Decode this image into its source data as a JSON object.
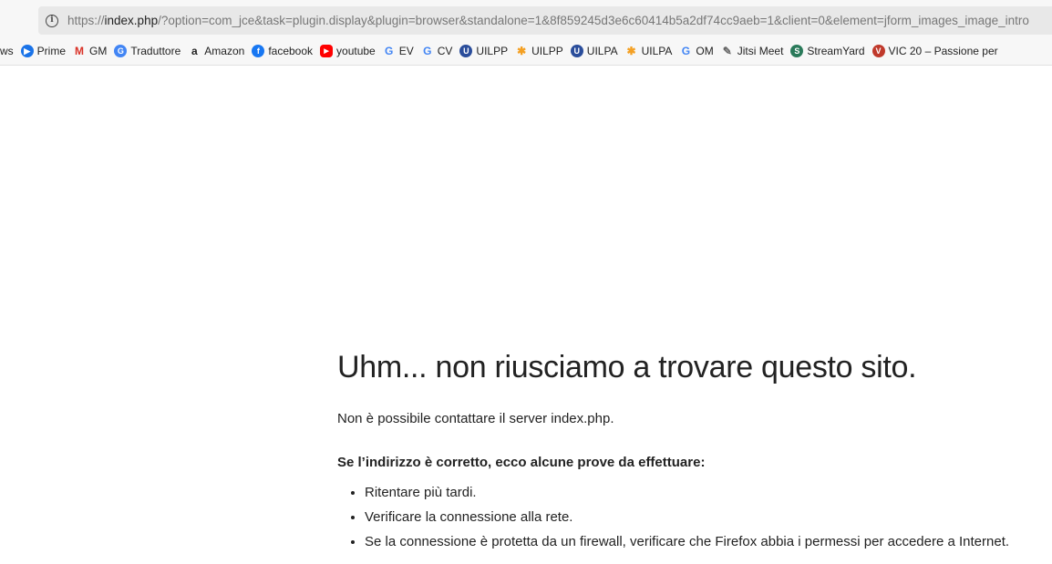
{
  "address_bar": {
    "scheme": "https://",
    "host": "index.php",
    "rest": "/?option=com_jce&task=plugin.display&plugin=browser&standalone=1&8f859245d3e6c60414b5a2df74cc9aeb=1&client=0&element=jform_images_image_intro"
  },
  "bookmarks": [
    {
      "label": "ws",
      "icon": "none",
      "color": ""
    },
    {
      "label": "Prime",
      "icon": "play-icon",
      "color": "#1a73e8"
    },
    {
      "label": "GM",
      "icon": "gmail-icon",
      "color": "#d93025"
    },
    {
      "label": "Traduttore",
      "icon": "translate-icon",
      "color": "#4285f4"
    },
    {
      "label": "Amazon",
      "icon": "amazon-icon",
      "color": "#222"
    },
    {
      "label": "facebook",
      "icon": "facebook-icon",
      "color": "#1877f2"
    },
    {
      "label": "youtube",
      "icon": "youtube-icon",
      "color": "#ff0000"
    },
    {
      "label": "EV",
      "icon": "google-icon",
      "color": "#4285f4"
    },
    {
      "label": "CV",
      "icon": "google-icon",
      "color": "#4285f4"
    },
    {
      "label": "UILPP",
      "icon": "uil-icon",
      "color": "#2a4d9b"
    },
    {
      "label": "UILPP",
      "icon": "joomla-icon",
      "color": "#f4a023"
    },
    {
      "label": "UILPA",
      "icon": "uil-icon",
      "color": "#2a4d9b"
    },
    {
      "label": "UILPA",
      "icon": "joomla-icon",
      "color": "#f4a023"
    },
    {
      "label": "OM",
      "icon": "google-icon",
      "color": "#4285f4"
    },
    {
      "label": "Jitsi Meet",
      "icon": "jitsi-icon",
      "color": "#666"
    },
    {
      "label": "StreamYard",
      "icon": "streamyard-icon",
      "color": "#2a7a5a"
    },
    {
      "label": "VIC 20 – Passione per",
      "icon": "vic20-icon",
      "color": "#c0392b"
    }
  ],
  "error": {
    "title": "Uhm... non riusciamo a trovare questo sito.",
    "message": "Non è possibile contattare il server index.php.",
    "tips_heading": "Se l’indirizzo è corretto, ecco alcune prove da effettuare:",
    "tips": [
      "Ritentare più tardi.",
      "Verificare la connessione alla rete.",
      "Se la connessione è protetta da un firewall, verificare che Firefox abbia i permessi per accedere a Internet."
    ]
  }
}
